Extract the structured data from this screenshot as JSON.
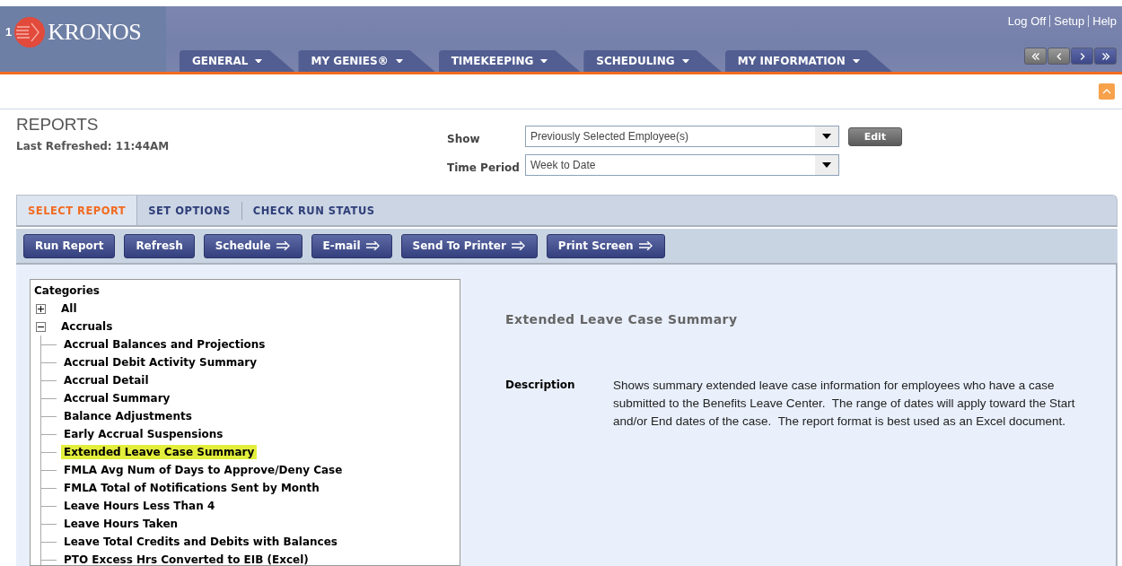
{
  "header": {
    "logo_number": "1",
    "logo_text": "KRONOS",
    "links": [
      "Log Off",
      "Setup",
      "Help"
    ],
    "menu_tabs": [
      {
        "label": "GENERAL",
        "selected": false
      },
      {
        "label": "MY GENIES®",
        "selected": false
      },
      {
        "label": "TIMEKEEPING",
        "selected": false
      },
      {
        "label": "SCHEDULING",
        "selected": false
      },
      {
        "label": "MY INFORMATION",
        "selected": false
      }
    ],
    "nav_buttons": [
      {
        "kind": "first",
        "disabled": true
      },
      {
        "kind": "prev",
        "disabled": true
      },
      {
        "kind": "next",
        "disabled": false
      },
      {
        "kind": "last",
        "disabled": false
      }
    ]
  },
  "page": {
    "title": "REPORTS",
    "last_refreshed": "Last Refreshed: 11:44AM",
    "filters": [
      {
        "label": "Show",
        "value": "Previously Selected Employee(s)"
      },
      {
        "label": "Time Period",
        "value": "Week to Date"
      }
    ],
    "edit_button": "Edit"
  },
  "tabs": [
    {
      "label": "SELECT REPORT",
      "selected": true
    },
    {
      "label": "SET OPTIONS",
      "selected": false
    },
    {
      "label": "CHECK RUN STATUS",
      "selected": false
    }
  ],
  "toolbar": [
    {
      "label": "Run Report",
      "arrow": false
    },
    {
      "label": "Refresh",
      "arrow": false
    },
    {
      "label": "Schedule",
      "arrow": true
    },
    {
      "label": "E-mail",
      "arrow": true
    },
    {
      "label": "Send To Printer",
      "arrow": true
    },
    {
      "label": "Print Screen",
      "arrow": true
    }
  ],
  "tree": {
    "title": "Categories",
    "items": [
      {
        "label": "All",
        "expanded": false,
        "selected": false
      },
      {
        "label": "Accruals",
        "expanded": true,
        "selected": false,
        "children": [
          {
            "label": "Accrual Balances and Projections",
            "selected": false
          },
          {
            "label": "Accrual Debit Activity Summary",
            "selected": false
          },
          {
            "label": "Accrual Detail",
            "selected": false
          },
          {
            "label": "Accrual Summary",
            "selected": false
          },
          {
            "label": "Balance Adjustments",
            "selected": false
          },
          {
            "label": "Early Accrual Suspensions",
            "selected": false
          },
          {
            "label": "Extended Leave Case Summary",
            "selected": true
          },
          {
            "label": "FMLA Avg Num of Days to Approve/Deny Case",
            "selected": false
          },
          {
            "label": "FMLA Total of Notifications Sent by Month",
            "selected": false
          },
          {
            "label": "Leave Hours Less Than 4",
            "selected": false
          },
          {
            "label": "Leave Hours Taken",
            "selected": false
          },
          {
            "label": "Leave Total Credits and Debits with Balances",
            "selected": false
          },
          {
            "label": "PTO Excess Hrs Converted to EIB (Excel)",
            "selected": false
          }
        ]
      }
    ]
  },
  "detail": {
    "title": "Extended Leave Case Summary",
    "description_label": "Description",
    "description": "Shows summary extended leave case information for employees who have a case submitted to the Benefits Leave Center.  The range of dates will apply toward the Start and/or End dates of the case.  The report format is best used as an Excel document."
  }
}
